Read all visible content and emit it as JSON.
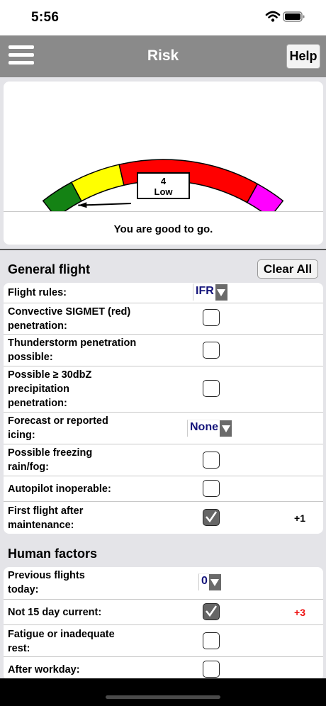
{
  "status_bar": {
    "time": "5:56"
  },
  "nav": {
    "title": "Risk",
    "help_label": "Help",
    "menu_icon": "hamburger-icon"
  },
  "gauge": {
    "value": 4,
    "level": "Low",
    "message": "You are good to go.",
    "colors": {
      "green": "#148214",
      "yellow": "#ffff00",
      "red": "#ff0000",
      "magenta": "#ff00ff"
    }
  },
  "general": {
    "title": "General flight",
    "clear_label": "Clear All",
    "rows": [
      {
        "label": "Flight rules:",
        "type": "select",
        "value": "IFR"
      },
      {
        "label": "Convective SIGMET (red) penetration:",
        "type": "checkbox",
        "checked": false
      },
      {
        "label": "Thunderstorm penetration possible:",
        "type": "checkbox",
        "checked": false
      },
      {
        "label": "Possible ≥ 30dbZ precipitation penetration:",
        "type": "checkbox",
        "checked": false
      },
      {
        "label": "Forecast or reported icing:",
        "type": "select",
        "value": "None"
      },
      {
        "label": "Possible freezing rain/fog:",
        "type": "checkbox",
        "checked": false
      },
      {
        "label": "Autopilot inoperable:",
        "type": "checkbox",
        "checked": false
      },
      {
        "label": "First flight after maintenance:",
        "type": "checkbox",
        "checked": true,
        "score": "+1"
      }
    ]
  },
  "human": {
    "title": "Human factors",
    "rows": [
      {
        "label": "Previous flights today:",
        "type": "select",
        "value": "0"
      },
      {
        "label": "Not 15 day current:",
        "type": "checkbox",
        "checked": true,
        "score": "+3"
      },
      {
        "label": "Fatigue or inadequate rest:",
        "type": "checkbox",
        "checked": false
      },
      {
        "label": "After workday:",
        "type": "checkbox",
        "checked": false
      }
    ]
  }
}
